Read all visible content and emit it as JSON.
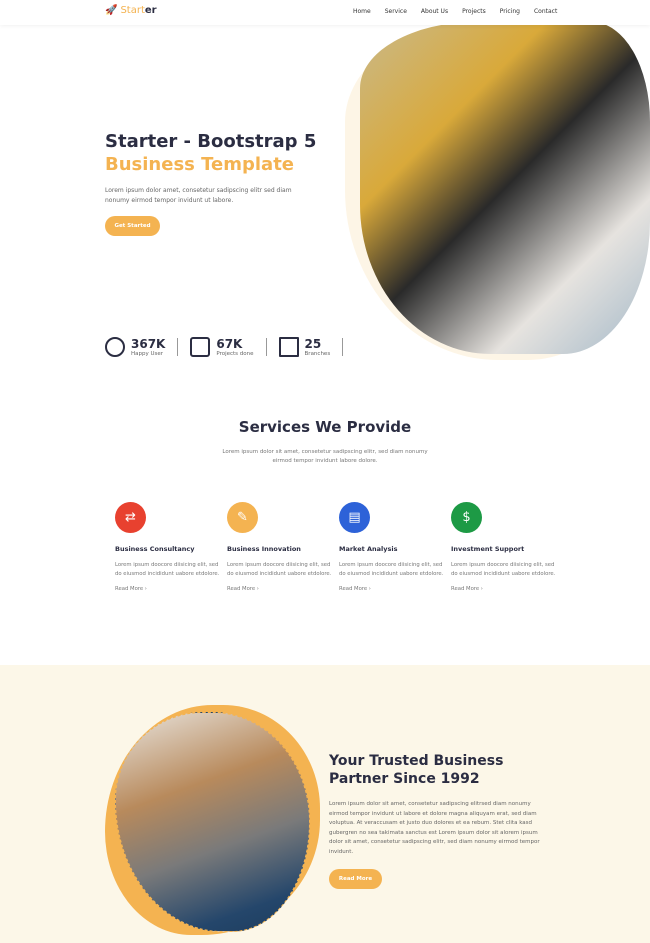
{
  "brand": {
    "logo_part1": "Start",
    "logo_part2": "er"
  },
  "nav": [
    "Home",
    "Service",
    "About Us",
    "Projects",
    "Pricing",
    "Contact"
  ],
  "hero": {
    "title_line1": "Starter - Bootstrap 5",
    "title_line2": "Business Template",
    "text": "Lorem ipsum dolor amet, consetetur sadipscing elitr sed diam nonumy eirmod tempor invidunt ut labore.",
    "cta": "Get Started"
  },
  "stats": [
    {
      "value": "367K",
      "label": "Happy User",
      "icon": "smile-icon"
    },
    {
      "value": "67K",
      "label": "Projects done",
      "icon": "certificate-icon"
    },
    {
      "value": "25",
      "label": "Branches",
      "icon": "building-icon"
    }
  ],
  "services": {
    "title": "Services We Provide",
    "text": "Lorem ipsum dolor sit amet, consetetur sadipscing elitr, sed diam nonumy eirmod tempor invidunt labore dolore.",
    "items": [
      {
        "title": "Business Consultancy",
        "text": "Lorem ipsum doocore diisicing elit, sed do eiusmod incididunt uabore etdolore.",
        "link": "Read More",
        "color": "#e8412f"
      },
      {
        "title": "Business Innovation",
        "text": "Lorem ipsum doocore diisicing elit, sed do eiusmod incididunt uabore etdolore.",
        "link": "Read More",
        "color": "#f4b351"
      },
      {
        "title": "Market Analysis",
        "text": "Lorem ipsum doocore diisicing elit, sed do eiusmod incididunt uabore etdolore.",
        "link": "Read More",
        "color": "#2d62d8"
      },
      {
        "title": "Investment Support",
        "text": "Lorem ipsum doocore diisicing elit, sed do eiusmod incididunt uabore etdolore.",
        "link": "Read More",
        "color": "#1d9a45"
      }
    ]
  },
  "about": {
    "title_line1": "Your Trusted Business",
    "title_line2": "Partner Since 1992",
    "text": "Lorem ipsum dolor sit amet, consetetur sadipscing elitrsed diam nonumy eirmod tempor invidunt ut labore et dolore magna aliquyam erat, sed diam voluptua. At veraccusam et justo duo dolores et ea rebum. Stet clita kasd gubergren no sea takimata sanctus est Lorem ipsum dolor sit alorem ipsum dolor sit amet, consetetur sadipscing elitr, sed diam nonumy eirmod tempor invidunt.",
    "cta": "Read More"
  }
}
